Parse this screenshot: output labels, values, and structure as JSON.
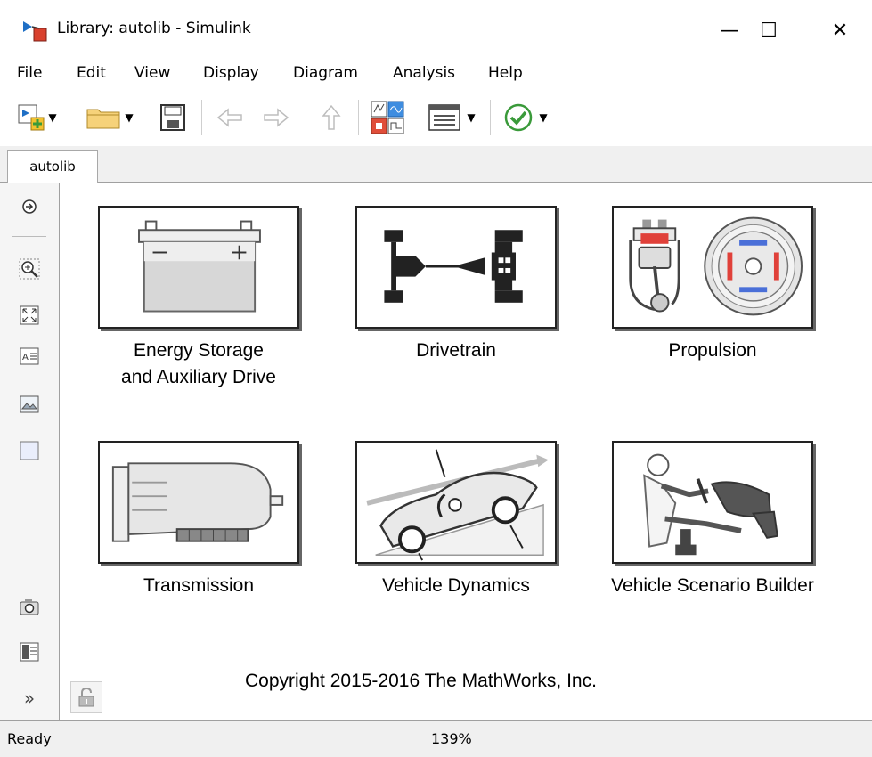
{
  "window": {
    "title": "Library: autolib - Simulink",
    "minimize_glyph": "—",
    "maximize_glyph": "☐",
    "close_glyph": "✕"
  },
  "menu": [
    {
      "label": "File",
      "id": "file"
    },
    {
      "label": "Edit",
      "id": "edit"
    },
    {
      "label": "View",
      "id": "view"
    },
    {
      "label": "Display",
      "id": "display"
    },
    {
      "label": "Diagram",
      "id": "diagram"
    },
    {
      "label": "Analysis",
      "id": "analysis"
    },
    {
      "label": "Help",
      "id": "help"
    }
  ],
  "tabs": {
    "active": "autolib"
  },
  "blocks": [
    {
      "label_line1": "Energy Storage",
      "label_line2": "and Auxiliary Drive"
    },
    {
      "label_line1": "Drivetrain",
      "label_line2": ""
    },
    {
      "label_line1": "Propulsion",
      "label_line2": ""
    },
    {
      "label_line1": "Transmission",
      "label_line2": ""
    },
    {
      "label_line1": "Vehicle Dynamics",
      "label_line2": ""
    },
    {
      "label_line1": "Vehicle Scenario Builder",
      "label_line2": ""
    }
  ],
  "canvas": {
    "copyright": "Copyright 2015-2016 The MathWorks, Inc."
  },
  "status": {
    "state": "Ready",
    "zoom": "139%"
  },
  "icons": {
    "new_model": "new-model-icon",
    "open": "open-folder-icon",
    "save": "save-icon",
    "back": "back-arrow-icon",
    "forward": "forward-arrow-icon",
    "up": "up-arrow-icon",
    "library_browser": "library-browser-icon",
    "model_config": "model-config-icon",
    "check": "check-icon"
  },
  "colors": {
    "accent_blue": "#1f6fc5",
    "check_green": "#3a9a3a",
    "motor_red": "#e0413a",
    "motor_blue": "#4a6fd8"
  }
}
